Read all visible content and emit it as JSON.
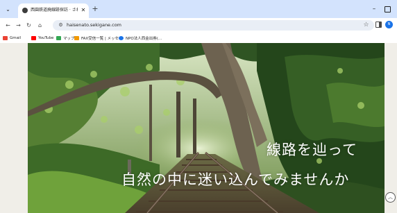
{
  "browser": {
    "tab": {
      "title": "西園鉄道廃線跡探訪 · さわやかに",
      "close_icon": "close-icon"
    },
    "toolbar": {
      "url": "haisenato.sekigane.com",
      "icons": [
        "back-arrow-icon",
        "forward-arrow-icon",
        "reload-icon",
        "home-icon",
        "site-info-icon",
        "star-icon",
        "side-panel-icon"
      ]
    },
    "profile_initial": "N",
    "bookmarks": [
      {
        "label": "Gmail",
        "icon_color": "#ea4335"
      },
      {
        "label": "YouTube",
        "icon_color": "#ff0000"
      },
      {
        "label": "マップ",
        "icon_color": "#34a853"
      },
      {
        "label": "FAX受信一覧 | メッセ…",
        "icon_color": "#f29900"
      },
      {
        "label": "NPO法人西金出券(…",
        "icon_color": "#1a73e8"
      }
    ]
  },
  "page": {
    "tagline_line1": "線路を辿って",
    "tagline_line2": "自然の中に迷い込んでみませんか"
  },
  "colors": {
    "tabstrip": "#d3e3fd",
    "page_bg": "#f0eee8",
    "foliage_dark": "#24461b",
    "foliage_light": "#8fbf4e",
    "rail": "#5a4636"
  }
}
